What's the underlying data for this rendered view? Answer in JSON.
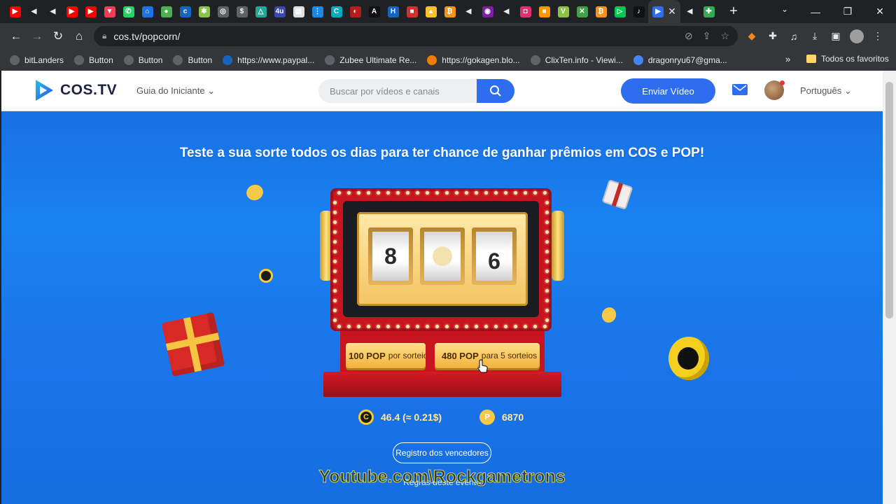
{
  "browser": {
    "tab_favicons": [
      {
        "icon": "youtube-icon",
        "color": "#ff0000",
        "glyph": "▶"
      },
      {
        "icon": "audio-tab-icon",
        "color": "#202124",
        "glyph": "◀"
      },
      {
        "icon": "audio-tab-icon",
        "color": "#202124",
        "glyph": "◀"
      },
      {
        "icon": "youtube-icon",
        "color": "#ff0000",
        "glyph": "▶"
      },
      {
        "icon": "youtube-icon",
        "color": "#ff0000",
        "glyph": "▶"
      },
      {
        "icon": "pocket-icon",
        "color": "#ef3e56",
        "glyph": "▼"
      },
      {
        "icon": "whatsapp-icon",
        "color": "#25d366",
        "glyph": "✆"
      },
      {
        "icon": "site-icon",
        "color": "#1a73e8",
        "glyph": "⌂"
      },
      {
        "icon": "site-icon",
        "color": "#4caf50",
        "glyph": "●"
      },
      {
        "icon": "site-icon",
        "color": "#1565c0",
        "glyph": "c"
      },
      {
        "icon": "site-icon",
        "color": "#8bc34a",
        "glyph": "✱"
      },
      {
        "icon": "site-icon",
        "color": "#5f6368",
        "glyph": "◎"
      },
      {
        "icon": "dollar-icon",
        "color": "#5f6368",
        "glyph": "$"
      },
      {
        "icon": "site-icon",
        "color": "#26a69a",
        "glyph": "△"
      },
      {
        "icon": "site-icon",
        "color": "#3949ab",
        "glyph": "4u"
      },
      {
        "icon": "site-icon",
        "color": "#e0e0e0",
        "glyph": "▤"
      },
      {
        "icon": "site-icon",
        "color": "#1e88e5",
        "glyph": "⋮"
      },
      {
        "icon": "site-icon",
        "color": "#00acc1",
        "glyph": "C"
      },
      {
        "icon": "site-icon",
        "color": "#b71c1c",
        "glyph": "◐"
      },
      {
        "icon": "site-icon",
        "color": "#111111",
        "glyph": "A"
      },
      {
        "icon": "site-icon",
        "color": "#1565c0",
        "glyph": "H"
      },
      {
        "icon": "site-icon",
        "color": "#d32f2f",
        "glyph": "■"
      },
      {
        "icon": "site-icon",
        "color": "#fbc02d",
        "glyph": "▲"
      },
      {
        "icon": "bitcoin-icon",
        "color": "#f7931a",
        "glyph": "₿"
      },
      {
        "icon": "audio-tab-icon",
        "color": "#202124",
        "glyph": "◀"
      },
      {
        "icon": "site-icon",
        "color": "#7b1fa2",
        "glyph": "◉"
      },
      {
        "icon": "audio-tab-icon",
        "color": "#202124",
        "glyph": "◀"
      },
      {
        "icon": "instagram-icon",
        "color": "#e1306c",
        "glyph": "◘"
      },
      {
        "icon": "site-icon",
        "color": "#ff9800",
        "glyph": "■"
      },
      {
        "icon": "site-icon",
        "color": "#8bc34a",
        "glyph": "V"
      },
      {
        "icon": "site-icon",
        "color": "#43a047",
        "glyph": "✕"
      },
      {
        "icon": "bitcoin-icon",
        "color": "#f7931a",
        "glyph": "₿"
      },
      {
        "icon": "play-icon",
        "color": "#00c853",
        "glyph": "▷"
      },
      {
        "icon": "tiktok-icon",
        "color": "#111111",
        "glyph": "♪"
      }
    ],
    "active_tab": {
      "icon": "cos-tv-icon",
      "close": "✕"
    },
    "tabs_after": [
      {
        "icon": "audio-tab-icon",
        "color": "#202124",
        "glyph": "◀"
      },
      {
        "icon": "extension-tab-icon",
        "color": "#34a853",
        "glyph": "✚"
      }
    ],
    "new_tab": "+",
    "url": "cos.tv/popcorn/",
    "bookmarks": [
      {
        "label": "bitLanders",
        "icon": "globe-icon",
        "color": "#5f6368"
      },
      {
        "label": "Button",
        "icon": "globe-icon",
        "color": "#5f6368"
      },
      {
        "label": "Button",
        "icon": "globe-icon",
        "color": "#5f6368"
      },
      {
        "label": "Button",
        "icon": "globe-icon",
        "color": "#5f6368"
      },
      {
        "label": "https://www.paypal...",
        "icon": "paypal-icon",
        "color": "#1565c0"
      },
      {
        "label": "Zubee Ultimate Re...",
        "icon": "globe-icon",
        "color": "#5f6368"
      },
      {
        "label": "https://gokagen.blo...",
        "icon": "blogger-icon",
        "color": "#f57c00"
      },
      {
        "label": "ClixTen.info - Viewi...",
        "icon": "globe-icon",
        "color": "#5f6368"
      },
      {
        "label": "dragonryu67@gma...",
        "icon": "google-icon",
        "color": "#4285f4"
      }
    ],
    "bookmarks_more": "»",
    "all_bookmarks": "Todos os favoritos"
  },
  "site": {
    "logo": "COS.TV",
    "guide": "Guia do Iniciante",
    "search_placeholder": "Buscar por vídeos e canais",
    "upload": "Enviar Vídeo",
    "language": "Português"
  },
  "game": {
    "headline": "Teste a sua sorte todos os dias para ter chance de ganhar prêmios em COS e POP!",
    "reels": [
      "8",
      "",
      "6"
    ],
    "single_draw_amount": "100 POP",
    "single_draw_text": "por sorteio",
    "multi_draw_amount": "480 POP",
    "multi_draw_text": "para 5 sorteios",
    "cos_balance": "46.4 (≈ 0.21$)",
    "pop_balance": "6870",
    "winners_button": "Registro dos vencedores",
    "rules_link": "Regras deste evento"
  },
  "overlay": {
    "watermark": "Youtube.com\\Rockgametrons"
  },
  "colors": {
    "brand_blue": "#2f6df0",
    "machine_red": "#c8141f",
    "gold": "#f2b23b",
    "page_blue": "#1a7ef0"
  }
}
